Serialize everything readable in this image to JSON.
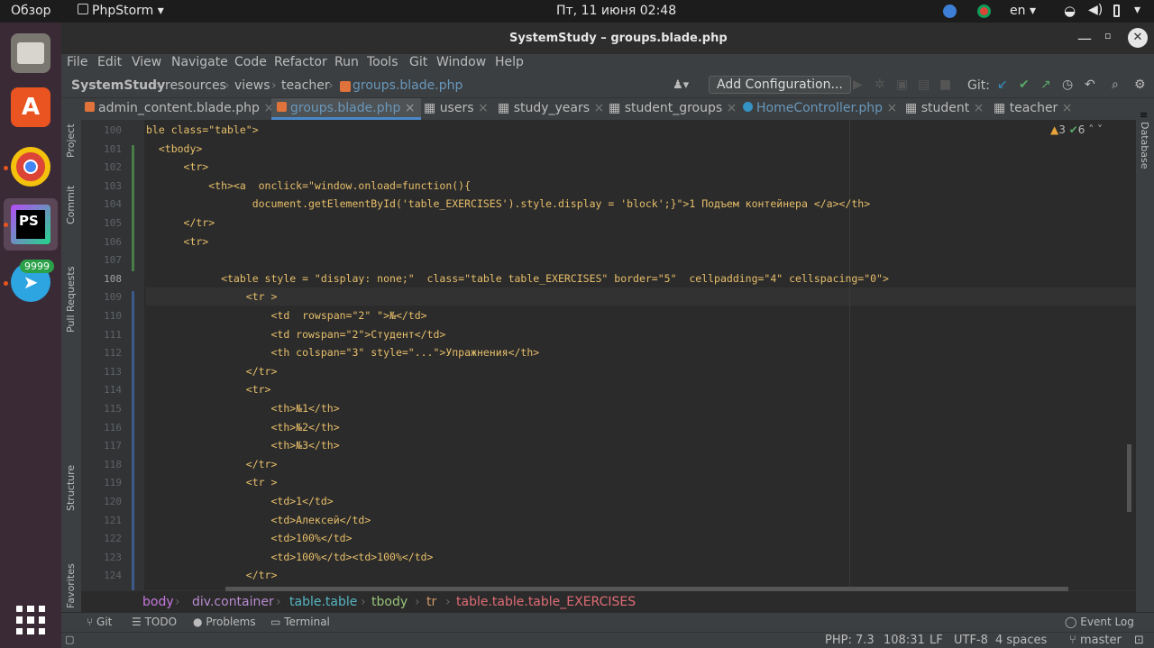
{
  "topbar": {
    "overview": "Обзор",
    "app": "PhpStorm",
    "datetime": "Пт, 11 июня  02:48",
    "lang": "en"
  },
  "dock": {
    "badge": "9999"
  },
  "window": {
    "title": "SystemStudy – groups.blade.php"
  },
  "menu": [
    "File",
    "Edit",
    "View",
    "Navigate",
    "Code",
    "Refactor",
    "Run",
    "Tools",
    "Git",
    "Window",
    "Help"
  ],
  "nav": {
    "project": "SystemStudy",
    "p1": "resources",
    "p2": "views",
    "p3": "teacher",
    "file": "groups.blade.php",
    "config": "Add Configuration...",
    "git": "Git:"
  },
  "tabs": [
    "admin_content.blade.php",
    "groups.blade.php",
    "users",
    "study_years",
    "student_groups",
    "HomeController.php",
    "student",
    "teacher"
  ],
  "side": {
    "project": "Project",
    "commit": "Commit",
    "pull": "Pull Requests",
    "structure": "Structure",
    "favorites": "Favorites",
    "database": "Database"
  },
  "inspections": {
    "warnings": "3",
    "weak": "6"
  },
  "lines": [
    {
      "n": "100",
      "t": "ble class=\"table\">"
    },
    {
      "n": "101",
      "t": "  <tbody>"
    },
    {
      "n": "102",
      "t": "      <tr>"
    },
    {
      "n": "103",
      "t": "          <th><a  onclick=\"window.onload=function(){"
    },
    {
      "n": "104",
      "t": "                 document.getElementById('table_EXERCISES').style.display = 'block';}\">1 Подъем контейнера </a></th>"
    },
    {
      "n": "105",
      "t": "      </tr>"
    },
    {
      "n": "106",
      "t": "      <tr>"
    },
    {
      "n": "107",
      "t": ""
    },
    {
      "n": "108",
      "t": "            <table style = \"display: none;\"  class=\"table table_EXERCISES\" border=\"5\"  cellpadding=\"4\" cellspacing=\"0\">"
    },
    {
      "n": "109",
      "t": "                <tr >"
    },
    {
      "n": "110",
      "t": "                    <td  rowspan=\"2\" \">№</td>"
    },
    {
      "n": "111",
      "t": "                    <td rowspan=\"2\">Студент</td>"
    },
    {
      "n": "112",
      "t": "                    <th colspan=\"3\" style=\"...\">Упражнения</th>"
    },
    {
      "n": "113",
      "t": "                </tr>"
    },
    {
      "n": "114",
      "t": "                <tr>"
    },
    {
      "n": "115",
      "t": "                    <th>№1</th>"
    },
    {
      "n": "116",
      "t": "                    <th>№2</th>"
    },
    {
      "n": "117",
      "t": "                    <th>№3</th>"
    },
    {
      "n": "118",
      "t": "                </tr>"
    },
    {
      "n": "119",
      "t": "                <tr >"
    },
    {
      "n": "120",
      "t": "                    <td>1</td>"
    },
    {
      "n": "121",
      "t": "                    <td>Алексей</td>"
    },
    {
      "n": "122",
      "t": "                    <td>100%</td>"
    },
    {
      "n": "123",
      "t": "                    <td>100%</td><td>100%</td>"
    },
    {
      "n": "124",
      "t": "                </tr>"
    }
  ],
  "crumbs": [
    "body",
    "div.container",
    "table.table",
    "tbody",
    "tr",
    "table.table.table_EXERCISES"
  ],
  "toolwindows": {
    "git": "Git",
    "todo": "TODO",
    "problems": "Problems",
    "terminal": "Terminal",
    "eventlog": "Event Log"
  },
  "status": {
    "php": "PHP: 7.3",
    "pos": "108:31",
    "lf": "LF",
    "enc": "UTF-8",
    "indent": "4 spaces",
    "branch": "master"
  }
}
